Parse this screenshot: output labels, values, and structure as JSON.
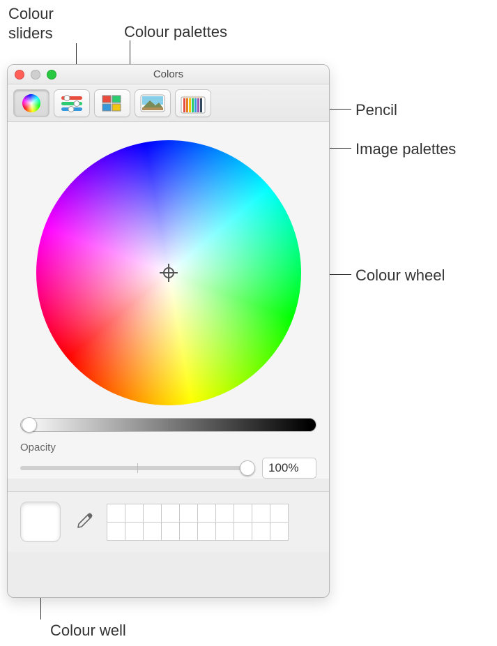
{
  "window": {
    "title": "Colors"
  },
  "toolbar": {
    "wheel_label": "Colour Wheel",
    "sliders_label": "Colour Sliders",
    "palettes_label": "Colour Palettes",
    "image_label": "Image Palettes",
    "pencils_label": "Pencils"
  },
  "brightness": {
    "value_pct": 0
  },
  "opacity": {
    "label": "Opacity",
    "value_pct": 100,
    "field_value": "100%"
  },
  "color_well": {
    "current_color": "#ffffff"
  },
  "swatches": {
    "rows": 2,
    "cols": 10
  },
  "callouts": {
    "sliders": "Colour\nsliders",
    "palettes": "Colour palettes",
    "pencil": "Pencil",
    "image_palettes": "Image palettes",
    "colour_wheel": "Colour wheel",
    "colour_well": "Colour well"
  }
}
